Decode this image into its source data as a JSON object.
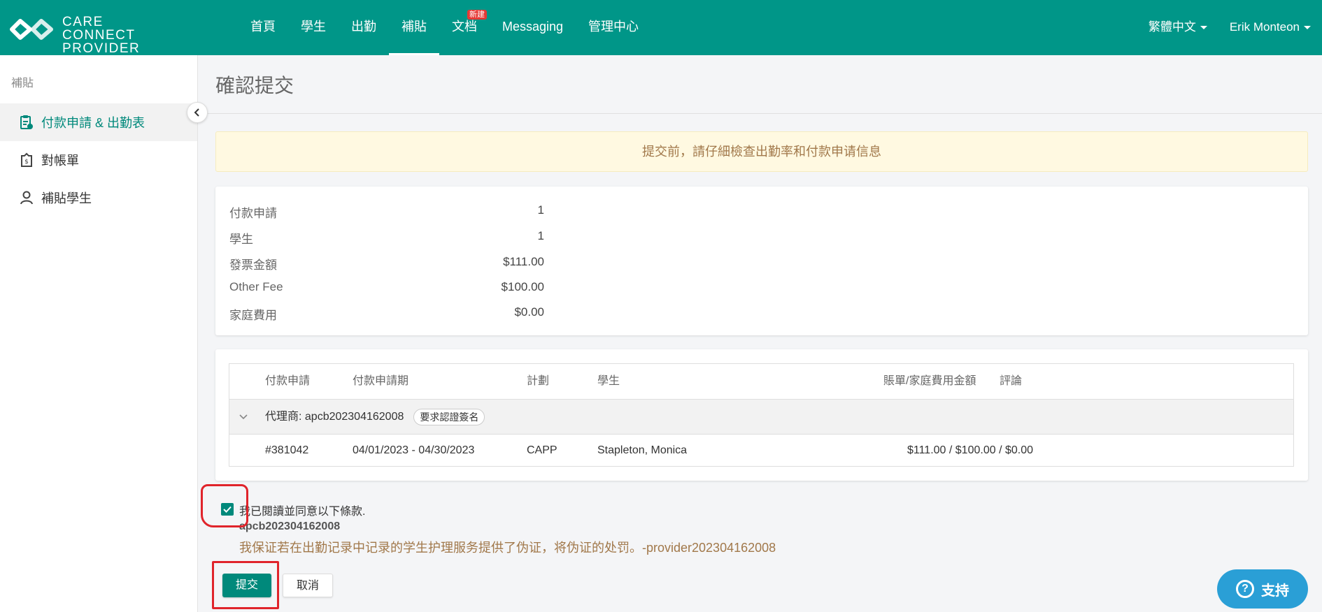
{
  "brand": {
    "line1": "CARE",
    "line2": "CONNECT PROVIDER"
  },
  "nav": {
    "items": [
      {
        "label": "首頁"
      },
      {
        "label": "學生"
      },
      {
        "label": "出勤"
      },
      {
        "label": "補貼"
      },
      {
        "label": "文档",
        "badge": "新建"
      },
      {
        "label": "Messaging"
      },
      {
        "label": "管理中心"
      }
    ],
    "language": "繁體中文",
    "user": "Erik Monteon"
  },
  "sidebar": {
    "section": "補貼",
    "items": [
      {
        "label": "付款申請 & 出勤表"
      },
      {
        "label": "對帳單"
      },
      {
        "label": "補貼學生"
      }
    ]
  },
  "page": {
    "title": "確認提交"
  },
  "alert": {
    "text": "提交前，請仔細檢查出勤率和付款申请信息"
  },
  "summary": [
    {
      "label": "付款申請",
      "value": "1"
    },
    {
      "label": "學生",
      "value": "1"
    },
    {
      "label": "發票金額",
      "value": "$111.00"
    },
    {
      "label": "Other Fee",
      "value": "$100.00"
    },
    {
      "label": "家庭費用",
      "value": "$0.00"
    }
  ],
  "table": {
    "headers": {
      "request": "付款申請",
      "period": "付款申請期",
      "plan": "計劃",
      "student": "學生",
      "amount": "賬單/家庭費用金額",
      "comment": "評論"
    },
    "group": {
      "label": "代理商: apcb202304162008",
      "badge": "要求認證簽名"
    },
    "rows": [
      {
        "request": "#381042",
        "period": "04/01/2023 - 04/30/2023",
        "plan": "CAPP",
        "student": "Stapleton, Monica",
        "amount": "$111.00 / $100.00 / $0.00",
        "comment": ""
      }
    ]
  },
  "agreement": {
    "checked": true,
    "label": "我已閱讀並同意以下條款.",
    "code": "apcb202304162008",
    "terms": "我保证若在出勤记录中记录的学生护理服务提供了伪证，将伪证的处罚。-provider202304162008"
  },
  "actions": {
    "submit": "提交",
    "cancel": "取消"
  },
  "support": {
    "label": "支持"
  },
  "colors": {
    "primary": "#009688",
    "alert_bg": "#fff9e1",
    "alert_text": "#a1784a",
    "highlight": "#e0242b",
    "support": "#2a9fd6"
  }
}
